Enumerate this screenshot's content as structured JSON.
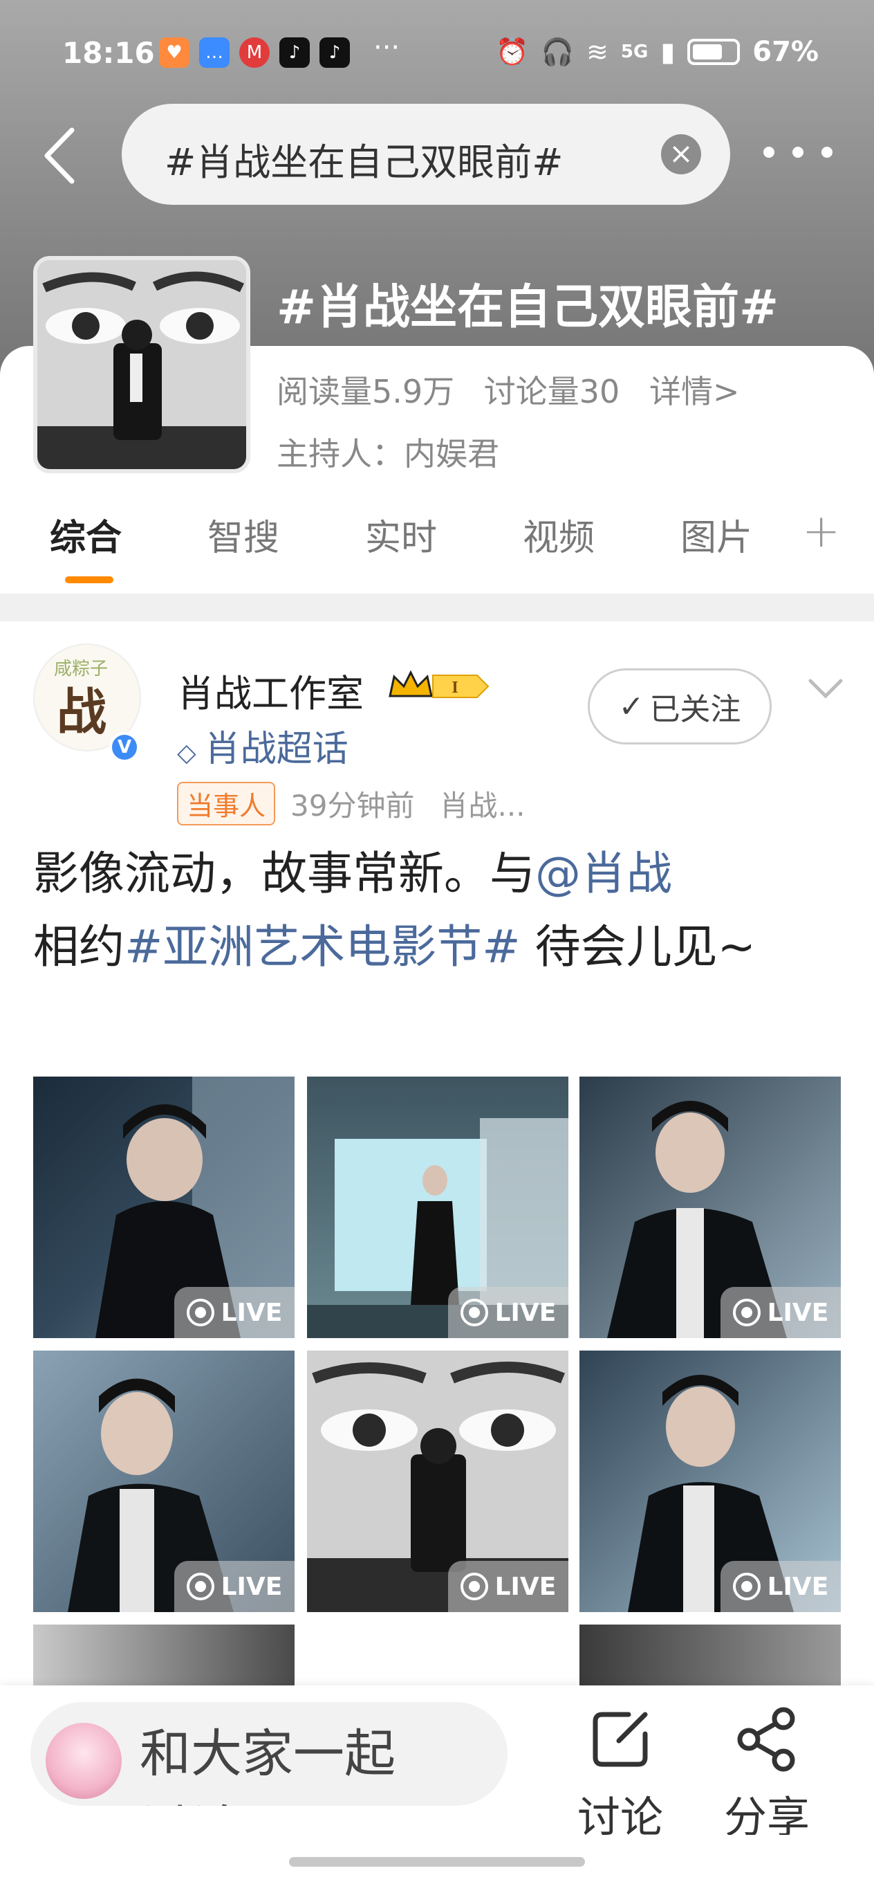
{
  "status_bar": {
    "time": "18:16",
    "overflow": "···",
    "battery": "67%",
    "network": "5G"
  },
  "search": {
    "query": "#肖战坐在自己双眼前#"
  },
  "topic": {
    "title": "#肖战坐在自己双眼前#",
    "reads": "阅读量5.9万",
    "discussions": "讨论量30",
    "details": "详情>",
    "host": "主持人：内娱君"
  },
  "tabs": [
    "综合",
    "智搜",
    "实时",
    "视频",
    "图片"
  ],
  "post": {
    "avatar_text": "战",
    "avatar_top": "咸粽子",
    "author": "肖战工作室",
    "level": "I",
    "supertopic": "肖战超话",
    "follow_label": "已关注",
    "party_badge": "当事人",
    "time": "39分钟前",
    "source": "肖战...",
    "text_1": "影像流动，故事常新。与",
    "mention": "@肖战",
    "text_2": "相约",
    "hashtag": "#亚洲艺术电影节#",
    "text_3": " 待会儿见~",
    "live_label": "LIVE"
  },
  "bottom": {
    "comment_placeholder": "和大家一起讨论",
    "discuss_label": "讨论",
    "share_label": "分享"
  },
  "colors": {
    "accent_orange": "#ff8a00",
    "link_blue": "#4b6a9b",
    "verified_blue": "#3d8bf5"
  }
}
